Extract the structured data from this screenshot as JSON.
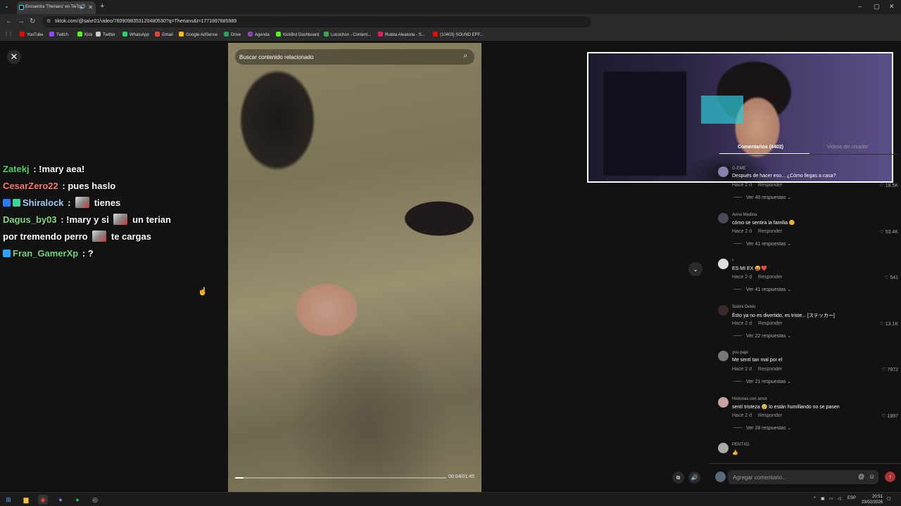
{
  "browser": {
    "tab_title": "Encuentra 'Therians' en TikTok",
    "tab_close": "✕",
    "speaker_glyph": "🔊",
    "new_tab": "+",
    "url": "tiktok.com/@saivr01/video/7609098353120480530?q=Therians&t=1771897885989",
    "window_controls": [
      "–",
      "▢",
      "✕"
    ],
    "bookmarks": [
      {
        "label": "YouTube",
        "color": "#ff0000"
      },
      {
        "label": "Twitch",
        "color": "#9146ff"
      },
      {
        "label": "Kick",
        "color": "#53fc18"
      },
      {
        "label": "Twitter",
        "color": "#cccccc"
      },
      {
        "label": "WhatsApp",
        "color": "#25d366"
      },
      {
        "label": "Gmail",
        "color": "#ea4335"
      },
      {
        "label": "Google AdSense",
        "color": "#fbbc04"
      },
      {
        "label": "Drive",
        "color": "#1fa463"
      },
      {
        "label": "Agenda",
        "color": "#8e44ad"
      },
      {
        "label": "KickBot Dashboard",
        "color": "#53fc18"
      },
      {
        "label": "Locochon - Content...",
        "color": "#34a853"
      },
      {
        "label": "Ruleta Aleatoria - S...",
        "color": "#e91e63"
      },
      {
        "label": "(10403) SOUND EFF...",
        "color": "#ff0000"
      }
    ]
  },
  "video": {
    "search_placeholder": "Buscar contenido relacionado",
    "time": "00:04/01:45",
    "progress_fraction": 0.04
  },
  "chat": [
    {
      "user": "Zatekj",
      "color": "#4cd964",
      "parts": [
        " : !mary aea!"
      ],
      "badges": []
    },
    {
      "user": "CesarZero22",
      "color": "#ff7a6e",
      "parts": [
        " : pues haslo"
      ],
      "badges": []
    },
    {
      "user": "Shiralock",
      "color": "#9fd3ff",
      "parts": [
        " : ",
        "EMOTE",
        " tienes"
      ],
      "badges": [
        "#2a7cff",
        "#3ad39a"
      ]
    },
    {
      "user": "Dagus_by03",
      "color": "#7fe07f",
      "parts": [
        " : !mary y si ",
        "EMOTE",
        " un terian"
      ],
      "badges": []
    },
    {
      "user": "",
      "color": "#ffffff",
      "parts": [
        "por tremendo perro ",
        "EMOTE",
        " te cargas"
      ],
      "badges": []
    },
    {
      "user": "Fran_GamerXp",
      "color": "#6fdc7c",
      "parts": [
        " : ?"
      ],
      "badges": [
        "#2aa5ff"
      ]
    }
  ],
  "comments_tabs": {
    "comments": "Comentarios (4402)",
    "creator_videos": "Videos del creador"
  },
  "comments": [
    {
      "user": "G-EME",
      "text": "Después de hacer eso... ¿Cómo llegas a casa?",
      "time": "Hace 2 d",
      "reply": "Responder",
      "likes": "♡ 18.5K",
      "replies": "Ver 40 respuestas ⌄",
      "avatar": "#8a7fb5"
    },
    {
      "user": "Anna Medina",
      "text": "cómo se sentira la familia 😊",
      "time": "Hace 2 d",
      "reply": "Responder",
      "likes": "♡ 53.4K",
      "replies": "Ver 41 respuestas ⌄",
      "avatar": "#4a4a5a"
    },
    {
      "user": "ᵡ",
      "text": "ES MI EX 😝❤️",
      "time": "Hace 2 d",
      "reply": "Responder",
      "likes": "♡ 541",
      "replies": "Ver 41 respuestas ⌄",
      "avatar": "#ddd"
    },
    {
      "user": "Sukini Dekki",
      "text": "Ésto ya no es divertido, es triste... [ステッカー]",
      "time": "Hace 2 d",
      "reply": "Responder",
      "likes": "♡ 13.1K",
      "replies": "Ver 22 respuestas ⌄",
      "avatar": "#3a2a2a"
    },
    {
      "user": "you papi",
      "text": "Me sentí tan mal por el",
      "time": "Hace 2 d",
      "reply": "Responder",
      "likes": "♡ 7972",
      "replies": "Ver 21 respuestas ⌄",
      "avatar": "#777"
    },
    {
      "user": "Historias con amor",
      "text": "sentí tristeza 😢 lo están humillando no se pasen",
      "time": "Hace 2 d",
      "reply": "Responder",
      "likes": "♡ 1897",
      "replies": "Ver 28 respuestas ⌄",
      "avatar": "#c9a0a0"
    },
    {
      "user": "PENTXG",
      "text": "👍",
      "time": "",
      "reply": "",
      "likes": "",
      "replies": "",
      "avatar": "#aaa"
    }
  ],
  "comment_input": {
    "placeholder": "Agregar comentario...",
    "mention_icon": "@",
    "emoji_icon": "☺"
  },
  "taskbar": {
    "lang": "ESP",
    "time": "20:51",
    "date": "23/02/2026"
  }
}
